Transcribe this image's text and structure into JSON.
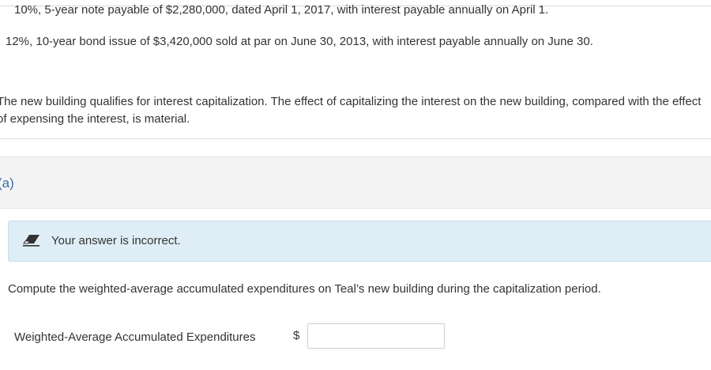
{
  "terms": [
    "10%, 5-year note payable of $2,280,000, dated April 1, 2017, with interest payable annually on April 1.",
    "12%, 10-year bond issue of $3,420,000 sold at par on June 30, 2013, with interest payable annually on June 30."
  ],
  "paragraph": "The new building qualifies for interest capitalization. The effect of capitalizing the interest on the new building, compared with the effect of expensing the interest, is material.",
  "part": {
    "label": "(a)"
  },
  "feedback": {
    "icon": "eraser-icon",
    "text": "Your answer is incorrect.",
    "background": "#dfeef6"
  },
  "question": "Compute the weighted-average accumulated expenditures on Teal’s new building during the capitalization period.",
  "answer_field": {
    "label": "Weighted-Average Accumulated Expenditures",
    "currency": "$",
    "value": ""
  }
}
